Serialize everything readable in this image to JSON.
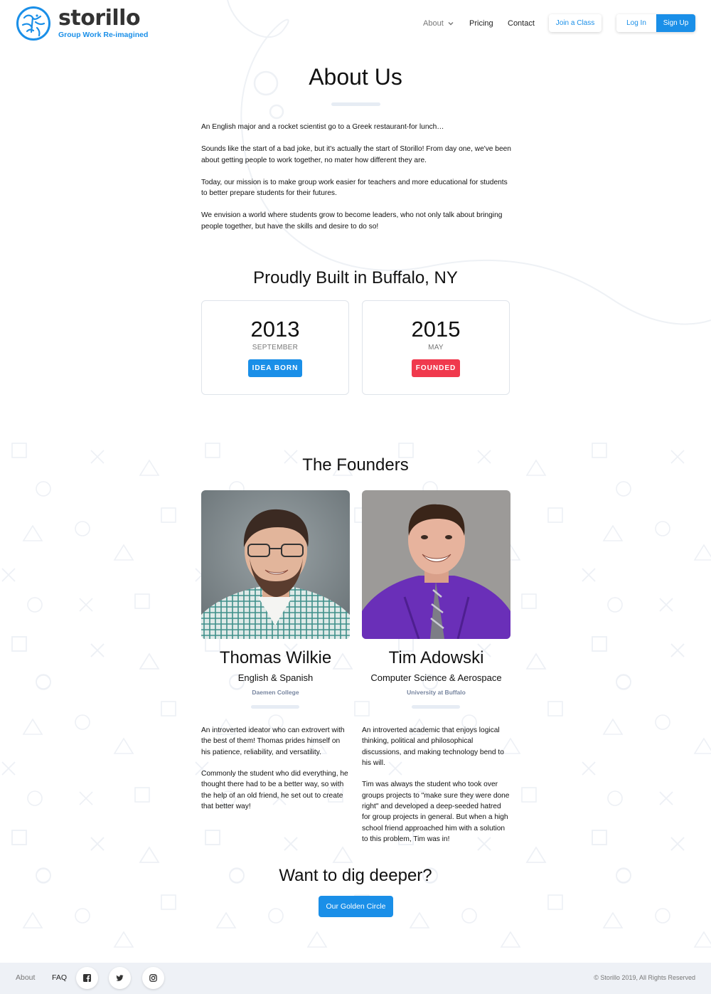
{
  "brand": {
    "name": "storillo",
    "tagline": "Group Work Re-imagined",
    "color": "#1a8fe8"
  },
  "nav": {
    "items": [
      {
        "label": "About",
        "icon": "chevron-down-icon"
      },
      {
        "label": "Pricing"
      },
      {
        "label": "Contact"
      }
    ],
    "join_label": "Join a Class",
    "login_label": "Log In",
    "signup_label": "Sign Up"
  },
  "about": {
    "title": "About Us",
    "paragraphs": [
      "An English major and a rocket scientist go to a Greek restaurant-for lunch…",
      "Sounds like the start of a bad joke, but it's actually the start of Storillo! From day one, we've been about getting people to work together, no mater how different they are.",
      "Today, our mission is to make group work easier for teachers and more educational for students to better prepare students for their futures.",
      "We envision a world where students grow to become leaders, who not only talk about bringing people together, but have the skills and desire to do so!"
    ]
  },
  "built": {
    "title": "Proudly Built in Buffalo, NY",
    "milestones": [
      {
        "year": "2013",
        "month": "SEPTEMBER",
        "badge": "IDEA BORN",
        "badge_color": "#1a8fe8"
      },
      {
        "year": "2015",
        "month": "MAY",
        "badge": "FOUNDED",
        "badge_color": "#f0394d"
      }
    ]
  },
  "founders": {
    "title": "The Founders",
    "people": [
      {
        "name": "Thomas Wilkie",
        "major": "English & Spanish",
        "school": "Daemen College",
        "bio": [
          "An introverted ideator who can extrovert with the best of them! Thomas prides himself on his patience, reliability, and versatility.",
          "Commonly the student who did everything, he thought there had to be a better way, so with the help of an old friend, he set out to create that better way!"
        ]
      },
      {
        "name": "Tim Adowski",
        "major": "Computer Science & Aerospace",
        "school": "University at Buffalo",
        "bio": [
          "An introverted academic that enjoys logical thinking, political and philosophical discussions, and making technology bend to his will.",
          "Tim was always the student who took over groups projects to \"make sure they were done right\" and developed a deep-seeded hatred for group projects in general. But when a high school friend approached him with a solution to this problem, Tim was in!"
        ]
      }
    ]
  },
  "cta": {
    "title": "Want to dig deeper?",
    "button_label": "Our Golden Circle"
  },
  "footer": {
    "links": [
      "About",
      "FAQ"
    ],
    "social": [
      "facebook-icon",
      "twitter-icon",
      "instagram-icon"
    ],
    "copyright": "© Storillo 2019, All Rights Reserved"
  }
}
